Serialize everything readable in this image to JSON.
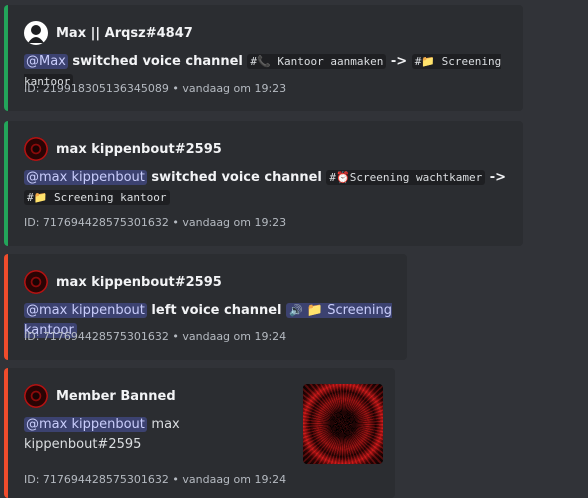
{
  "colors": {
    "background": "#313338",
    "embed_bg": "#2b2d31",
    "green_accent": "#23a55a",
    "red_accent": "#f04c2c",
    "mention_bg": "#3c4270"
  },
  "embeds": [
    {
      "author": "Max || Arqsz#4847",
      "avatar_icon": "white-avatar-icon",
      "mention": "@Max",
      "action": "switched voice channel",
      "from_channel": "#📞 Kantoor aanmaken",
      "arrow": "->",
      "to_channel": "#📁 Screening kantoor",
      "footer": "ID: 219918305136345089 • vandaag om 19:23"
    },
    {
      "author": "max kippenbout#2595",
      "avatar_icon": "dark-red-avatar-icon",
      "mention": "@max kippenbout",
      "action": "switched voice channel",
      "from_channel": "#⏰Screening wachtkamer",
      "arrow": "->",
      "to_channel": "#📁 Screening kantoor",
      "footer": "ID: 717694428575301632 • vandaag om 19:23"
    },
    {
      "author": "max kippenbout#2595",
      "avatar_icon": "dark-red-avatar-icon",
      "mention": "@max kippenbout",
      "action": "left voice channel",
      "channel": "📁 Screening kantoor",
      "channel_icon": "speaker-icon",
      "footer": "ID: 717694428575301632 • vandaag om 19:24"
    },
    {
      "author": "Member Banned",
      "avatar_icon": "dark-red-avatar-icon",
      "mention": "@max kippenbout",
      "username": "max kippenbout#2595",
      "thumbnail_icon": "red-circle-thumbnail",
      "footer": "ID: 717694428575301632 • vandaag om 19:24"
    }
  ]
}
